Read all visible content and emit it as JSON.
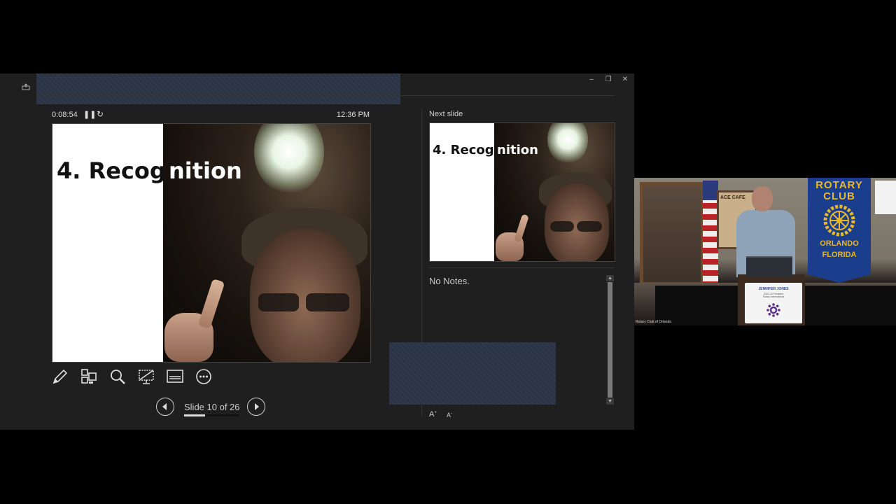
{
  "presenter": {
    "timer": "0:08:54",
    "clock": "12:36 PM",
    "next_slide_label": "Next slide",
    "notes": "No Notes.",
    "slide_counter": "Slide 10 of 26",
    "progress": 0.385,
    "current_slide": {
      "title_part1": "4. Recog",
      "title_part2": "nition"
    },
    "next_slide": {
      "title_part1": "4. Recog",
      "title_part2": "nition"
    },
    "window_controls": [
      "minimize",
      "restore",
      "close"
    ],
    "tools": [
      "pen-icon",
      "slides-grid-icon",
      "zoom-icon",
      "black-screen-icon",
      "subtitles-icon",
      "more-icon"
    ]
  },
  "video": {
    "caption": "Rotary Club of Orlando",
    "banner": {
      "line1": "ROTARY",
      "line2": "CLUB",
      "line3": "ORLANDO",
      "line4": "FLORIDA"
    },
    "placard": {
      "name": "JENNIFER JONES",
      "sub1": "2022-23 President",
      "sub2": "Rotary International"
    },
    "poster_text": "ACE CAFE"
  }
}
